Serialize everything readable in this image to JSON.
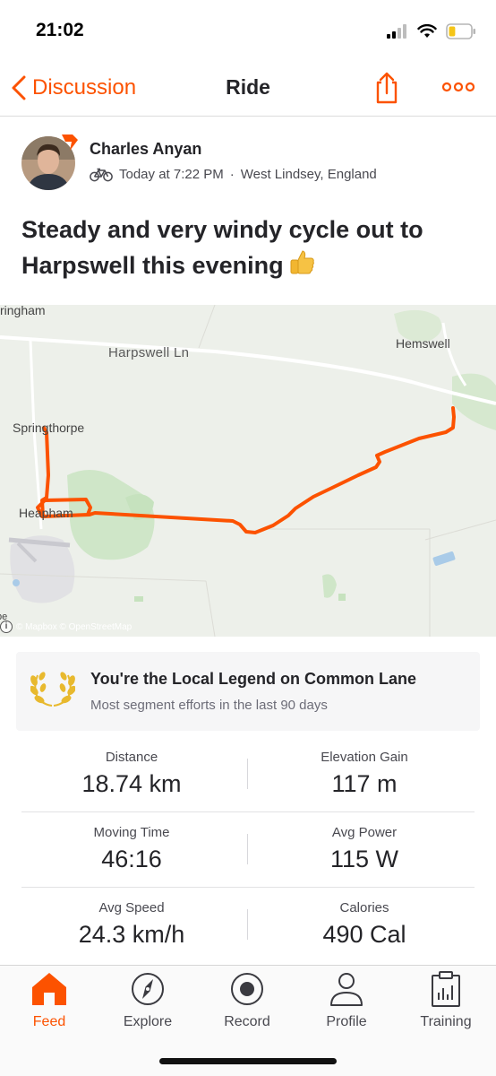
{
  "status_bar": {
    "time": "21:02",
    "icons": [
      "signal-icon",
      "wifi-icon",
      "battery-icon"
    ],
    "battery_level": 0.3
  },
  "nav": {
    "back_label": "Discussion",
    "title": "Ride",
    "share_icon": "share-icon",
    "more_icon": "more-icon"
  },
  "activity": {
    "athlete_name": "Charles Anyan",
    "sport_icon": "bike-icon",
    "timestamp": "Today at 7:22 PM",
    "separator": "·",
    "location": "West Lindsey, England",
    "title": "Steady and very windy cycle out to Harpswell this evening",
    "title_emoji": "thumbs-up-icon"
  },
  "map": {
    "labels": {
      "top_left": "ringham",
      "road": "Harpswell Ln",
      "village_east": "Hemswell",
      "village_north": "Springthorpe",
      "village_south": "Heapham",
      "edge_bottom_left": "pe"
    },
    "attribution": "© Mapbox © OpenStreetMap",
    "route_color": "#fc5200"
  },
  "achievement": {
    "icon": "laurel-icon",
    "title": "You're the Local Legend on Common Lane",
    "subtitle": "Most segment efforts in the last 90 days"
  },
  "stats": [
    {
      "label": "Distance",
      "value": "18.74 km"
    },
    {
      "label": "Elevation Gain",
      "value": "117 m"
    },
    {
      "label": "Moving Time",
      "value": "46:16"
    },
    {
      "label": "Avg Power",
      "value": "115 W"
    },
    {
      "label": "Avg Speed",
      "value": "24.3 km/h"
    },
    {
      "label": "Calories",
      "value": "490 Cal"
    }
  ],
  "tab_bar": {
    "active": "Feed",
    "items": [
      {
        "label": "Feed",
        "icon": "home-icon"
      },
      {
        "label": "Explore",
        "icon": "compass-icon"
      },
      {
        "label": "Record",
        "icon": "record-icon"
      },
      {
        "label": "Profile",
        "icon": "person-icon"
      },
      {
        "label": "Training",
        "icon": "clipboard-chart-icon"
      }
    ]
  },
  "colors": {
    "accent": "#fc5200",
    "text_primary": "#242428",
    "text_secondary": "#494950",
    "gold": "#e8b92e"
  }
}
